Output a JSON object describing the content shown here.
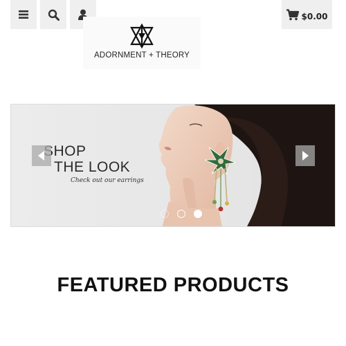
{
  "header": {
    "icons": {
      "menu": "hamburger-icon",
      "search": "search-icon",
      "account": "user-icon",
      "cart": "cart-icon"
    },
    "cart_total": "$0.00"
  },
  "logo": {
    "text": "ADORNMENT + THEORY"
  },
  "hero": {
    "line1": "SHOP",
    "line2": "THE LOOK",
    "subtitle": "Check out our earrings",
    "slide_count": 3,
    "active_slide": 3
  },
  "featured": {
    "title": "FEATURED PRODUCTS"
  }
}
